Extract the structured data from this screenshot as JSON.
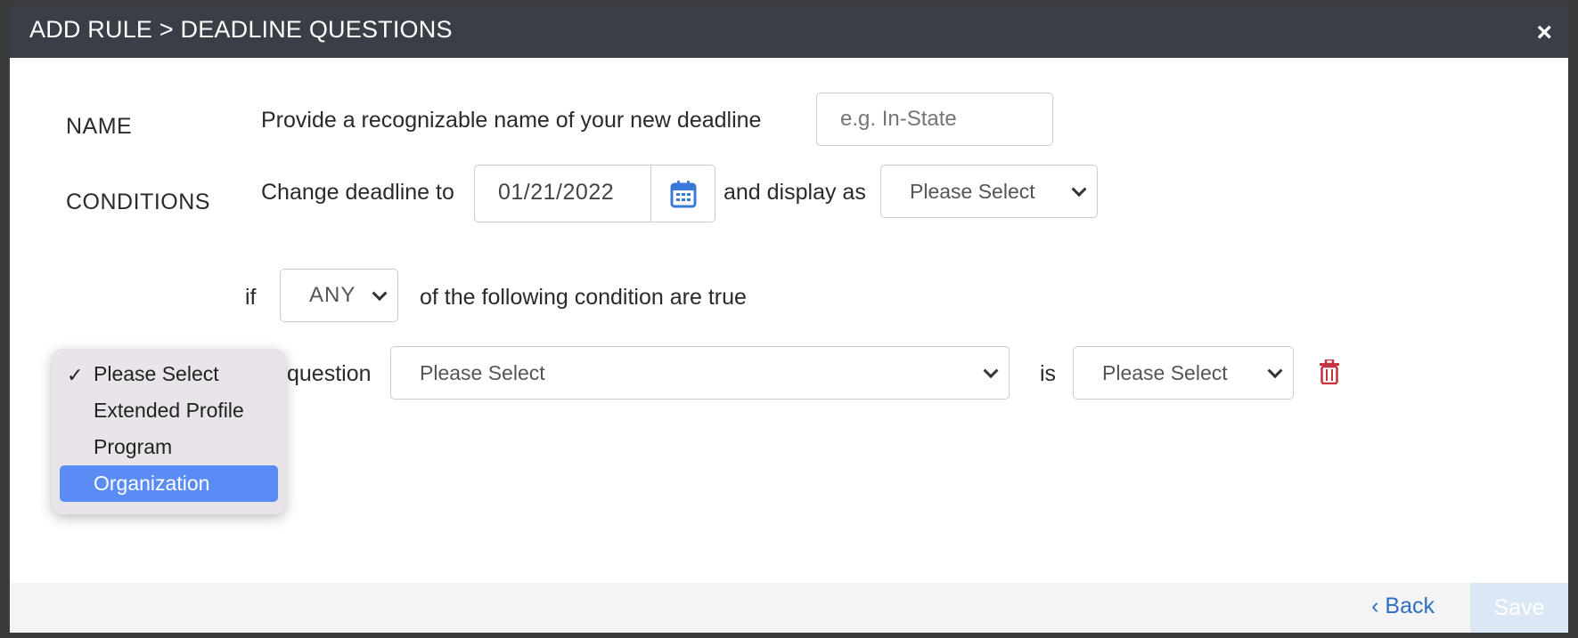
{
  "modal": {
    "title": "ADD RULE > DEADLINE QUESTIONS",
    "close_label": "×"
  },
  "name_section": {
    "label": "NAME",
    "instruction": "Provide a recognizable name of your new deadline",
    "placeholder": "e.g. In-State",
    "value": ""
  },
  "conditions_section": {
    "label": "CONDITIONS",
    "change_text": "Change deadline to",
    "date_value": "01/21/2022",
    "date_icon": "calendar-icon",
    "display_text": "and display as",
    "display_select": "Please Select"
  },
  "match": {
    "if_text": "if",
    "mode": "ANY",
    "suffix_text": "of the following condition are true"
  },
  "condition_row": {
    "question_text": "question",
    "question_select": "Please Select",
    "is_text": "is",
    "value_select": "Please Select",
    "delete_icon": "trash-icon",
    "delete_color": "#c3343f"
  },
  "type_menu": {
    "options": [
      {
        "label": "Please Select",
        "checked": true
      },
      {
        "label": "Extended Profile"
      },
      {
        "label": "Program"
      },
      {
        "label": "Organization",
        "highlighted": true
      }
    ],
    "check_mark": "✓",
    "highlight_color": "#5b8bf5"
  },
  "footer": {
    "back_label": "‹ Back",
    "save_label": "Save"
  }
}
